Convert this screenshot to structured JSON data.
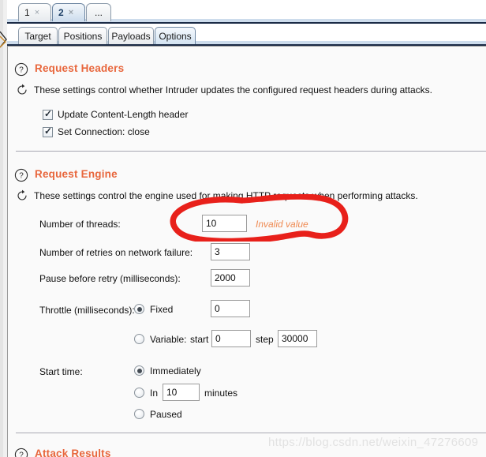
{
  "window": {
    "attack_tabs": [
      {
        "label": "1",
        "close": "×",
        "selected": false
      },
      {
        "label": "2",
        "close": "×",
        "selected": true
      },
      {
        "label": "...",
        "close": "",
        "selected": false
      }
    ],
    "main_tabs": [
      {
        "label": "Target",
        "selected": false
      },
      {
        "label": "Positions",
        "selected": false
      },
      {
        "label": "Payloads",
        "selected": false
      },
      {
        "label": "Options",
        "selected": true
      }
    ]
  },
  "sections": {
    "request_headers": {
      "title": "Request Headers",
      "description": "These settings control whether Intruder updates the configured request headers during attacks.",
      "help_icon": "question-circle-icon",
      "reset_icon": "refresh-icon",
      "checkboxes": [
        {
          "label": "Update Content-Length header",
          "checked": true
        },
        {
          "label": "Set Connection: close",
          "checked": true
        }
      ]
    },
    "request_engine": {
      "title": "Request Engine",
      "description": "These settings control the engine used for making HTTP requests when performing attacks.",
      "help_icon": "question-circle-icon",
      "reset_icon": "refresh-icon",
      "fields": {
        "threads_label": "Number of threads:",
        "threads_value": "10",
        "threads_error": "Invalid value",
        "retries_label": "Number of retries on network failure:",
        "retries_value": "3",
        "pause_label": "Pause before retry (milliseconds):",
        "pause_value": "2000",
        "throttle_label": "Throttle (milliseconds):",
        "throttle_fixed_label": "Fixed",
        "throttle_fixed_value": "0",
        "throttle_fixed_selected": true,
        "throttle_variable_label": "Variable:",
        "throttle_variable_start_label": "start",
        "throttle_variable_start_value": "0",
        "throttle_variable_step_label": "step",
        "throttle_variable_step_value": "30000",
        "throttle_variable_selected": false,
        "start_time_label": "Start time:",
        "start_immediately_label": "Immediately",
        "start_immediately_selected": true,
        "start_in_label": "In",
        "start_in_value": "10",
        "start_in_units": "minutes",
        "start_in_selected": false,
        "start_paused_label": "Paused",
        "start_paused_selected": false
      }
    },
    "attack_results": {
      "title": "Attack Results",
      "help_icon": "question-circle-icon"
    }
  },
  "annotation": {
    "shape": "hand-drawn-red-ellipse",
    "color": "#e8201a"
  },
  "watermark": {
    "text": "https://blog.csdn.net/weixin_47276609"
  },
  "colors": {
    "section_title": "#e8663c",
    "error_text": "#ef8a52",
    "tab_selected_bg": "#d3e2f1",
    "panel_bg": "#fafafa"
  }
}
